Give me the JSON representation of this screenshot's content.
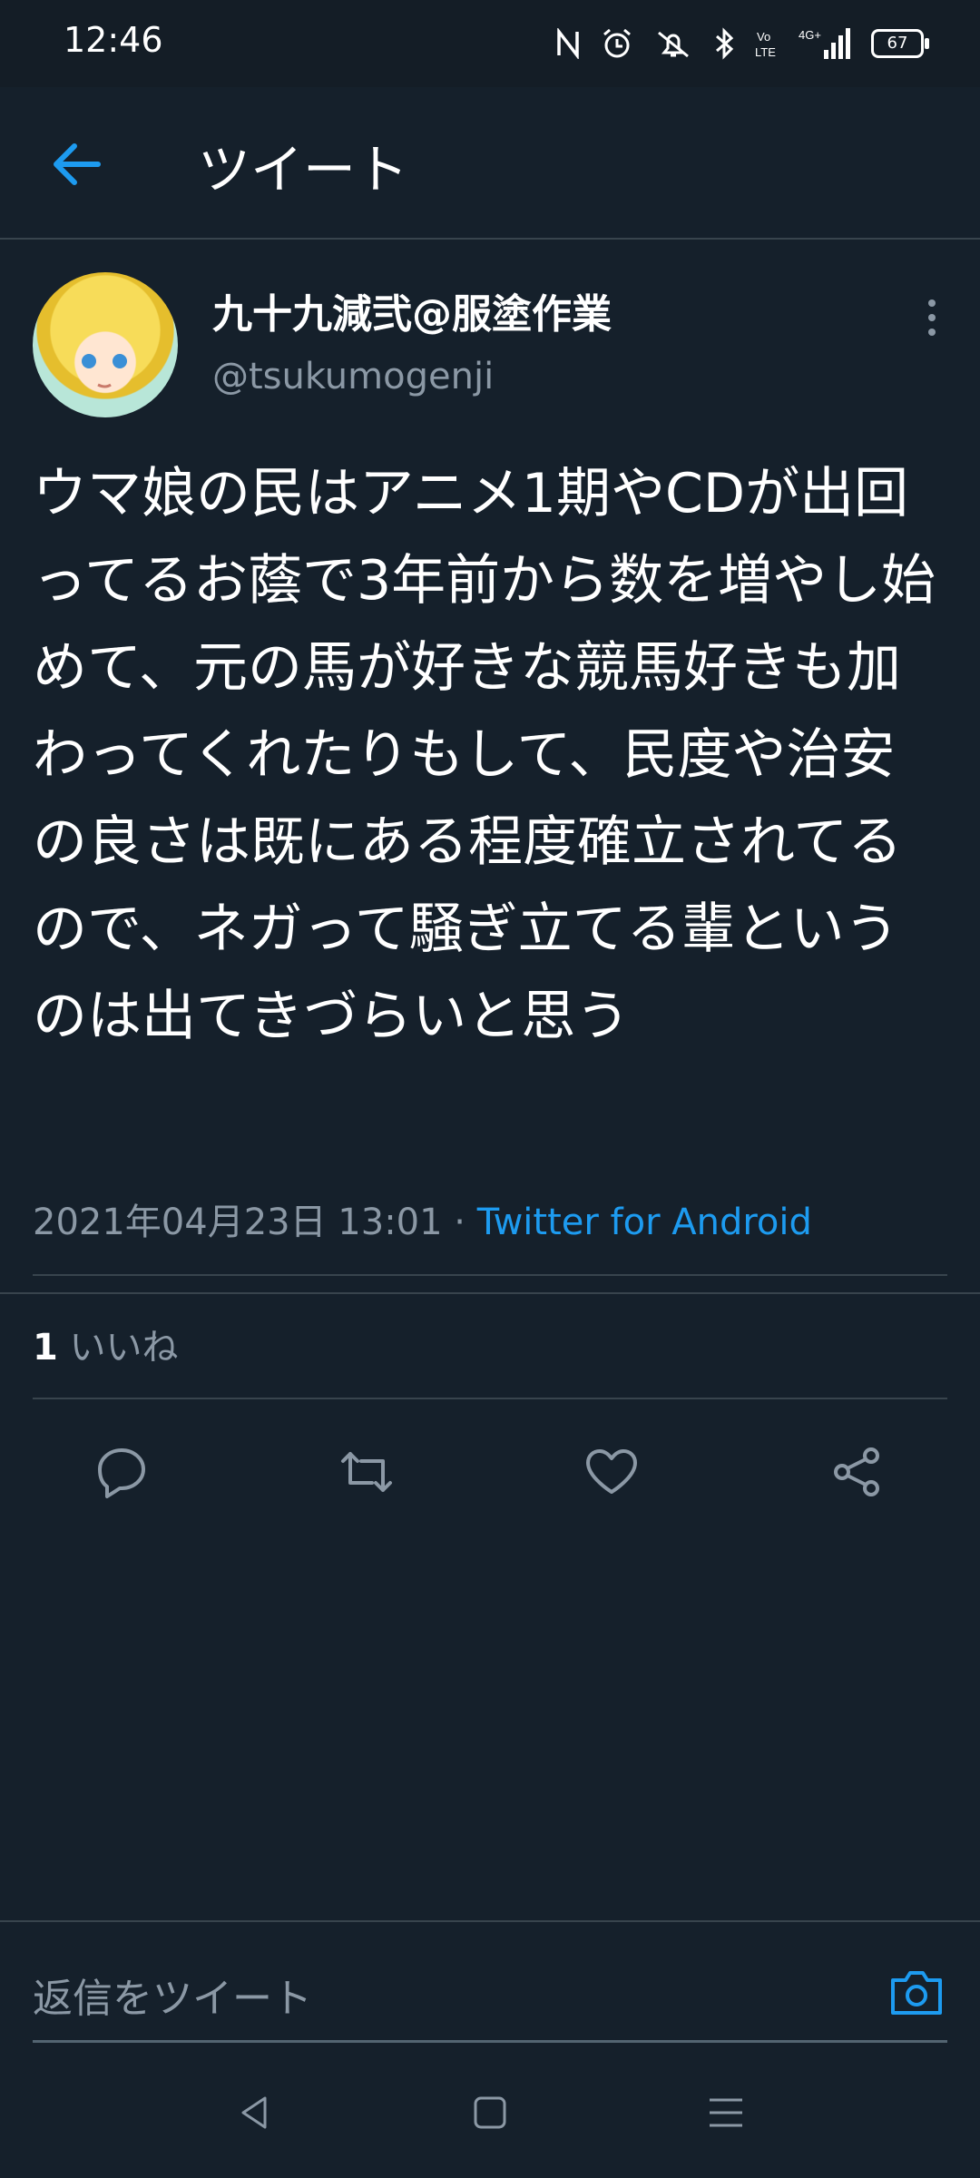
{
  "status_bar": {
    "time": "12:46",
    "network": "4G+",
    "battery": "67"
  },
  "header": {
    "title": "ツイート"
  },
  "tweet": {
    "display_name": "九十九減弐@服塗作業",
    "handle": "@tsukumogenji",
    "text": "ウマ娘の民はアニメ1期やCDが出回ってるお蔭で3年前から数を増やし始めて、元の馬が好きな競馬好きも加わってくれたりもして、民度や治安の良さは既にある程度確立されてるので、ネガって騒ぎ立てる輩というのは出てきづらいと思う",
    "timestamp": "2021年04月23日 13:01",
    "separator": " · ",
    "source": "Twitter for Android",
    "likes_count": "1",
    "likes_label": " いいね"
  },
  "actions": [
    "reply-icon",
    "retweet-icon",
    "like-icon",
    "share-icon"
  ],
  "reply": {
    "placeholder": "返信をツイート"
  },
  "colors": {
    "background": "#15202b",
    "accent": "#1d9bf0",
    "secondary_text": "#8b98a5",
    "divider": "#38444d"
  }
}
